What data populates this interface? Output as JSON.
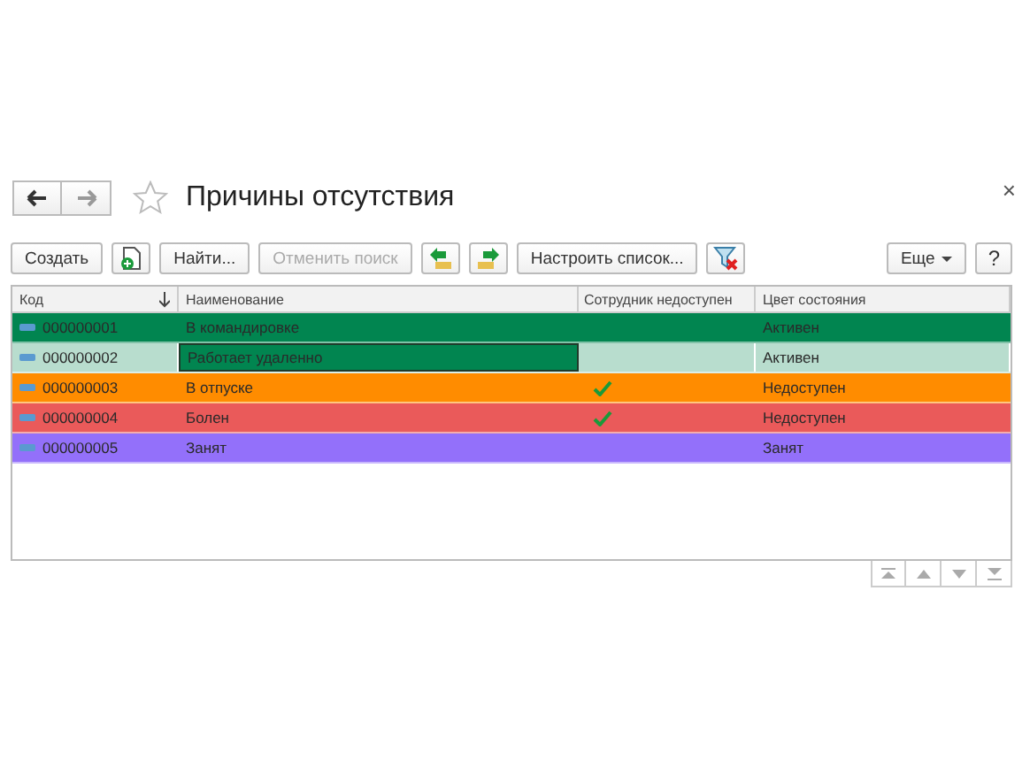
{
  "window": {
    "title": "Причины отсутствия",
    "close": "×"
  },
  "toolbar": {
    "create": "Создать",
    "find": "Найти...",
    "cancel_search": {
      "label": "Отменить поиск",
      "disabled": true
    },
    "configure": "Настроить список...",
    "more": "Еще",
    "help": "?"
  },
  "table": {
    "columns": [
      "Код",
      "Наименование",
      "Сотрудник недоступен",
      "Цвет состояния"
    ],
    "rows": [
      {
        "code": "000000001",
        "name": "В командировке",
        "unavailable": false,
        "status": "Активен",
        "color": "#018550",
        "selected": false
      },
      {
        "code": "000000002",
        "name": "Работает удаленно",
        "unavailable": false,
        "status": "Активен",
        "color": "#018550",
        "selected": true
      },
      {
        "code": "000000003",
        "name": "В отпуске",
        "unavailable": true,
        "status": "Недоступен",
        "color": "#ff8c00",
        "selected": false
      },
      {
        "code": "000000004",
        "name": "Болен",
        "unavailable": true,
        "status": "Недоступен",
        "color": "#ea5a5a",
        "selected": false
      },
      {
        "code": "000000005",
        "name": "Занят",
        "unavailable": false,
        "status": "Занят",
        "color": "#9370fa",
        "selected": false
      }
    ]
  }
}
